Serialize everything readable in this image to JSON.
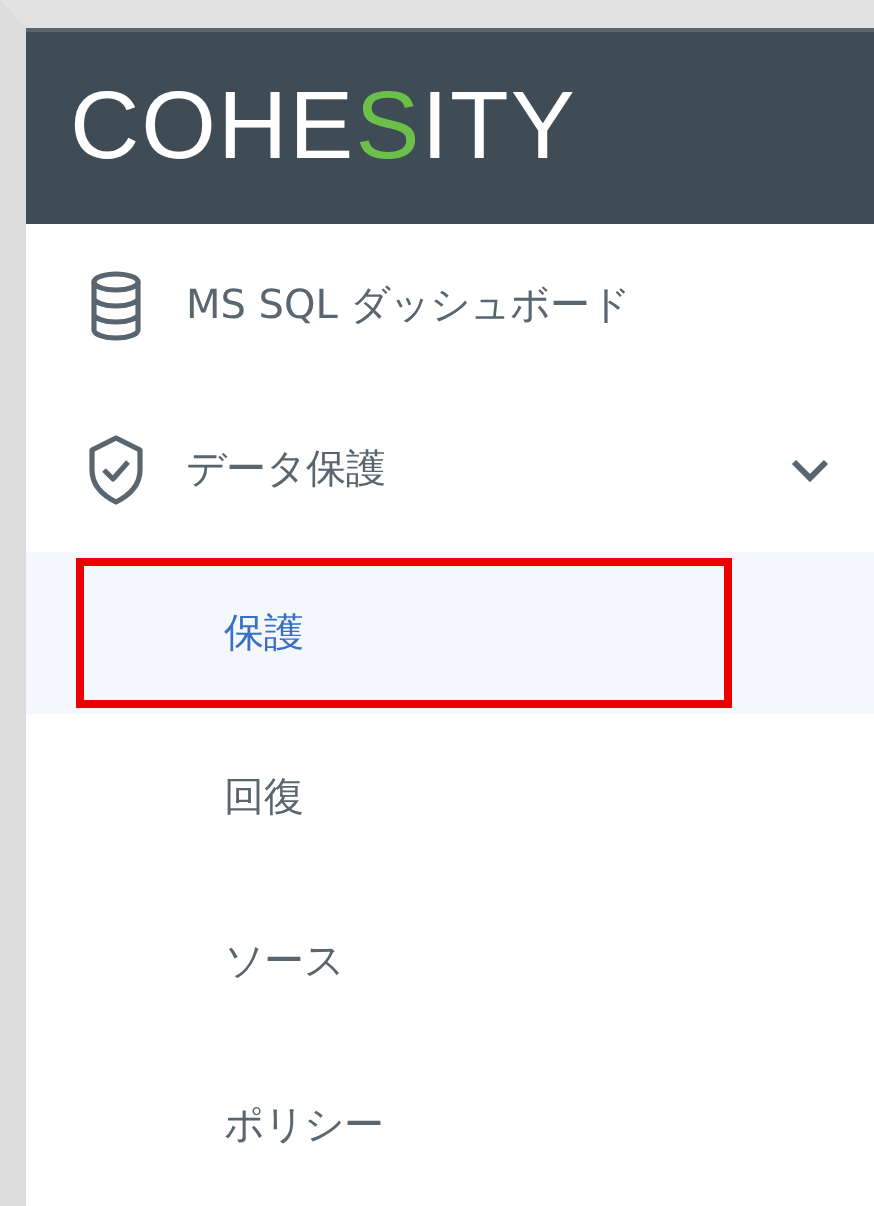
{
  "logo": [
    {
      "text": "COHE",
      "accent": false
    },
    {
      "text": "S",
      "accent": true
    },
    {
      "text": "ITY",
      "accent": false
    }
  ],
  "nav": [
    {
      "label": "MS SQL ダッシュボード",
      "kind": "database"
    },
    {
      "label": "データ保護",
      "kind": "shield",
      "expanded": true,
      "children": [
        {
          "label": "保護",
          "selected": true,
          "highlighted": true
        },
        {
          "label": "回復",
          "selected": false,
          "highlighted": false
        },
        {
          "label": "ソース",
          "selected": false,
          "highlighted": false
        },
        {
          "label": "ポリシー",
          "selected": false,
          "highlighted": false
        }
      ]
    }
  ]
}
